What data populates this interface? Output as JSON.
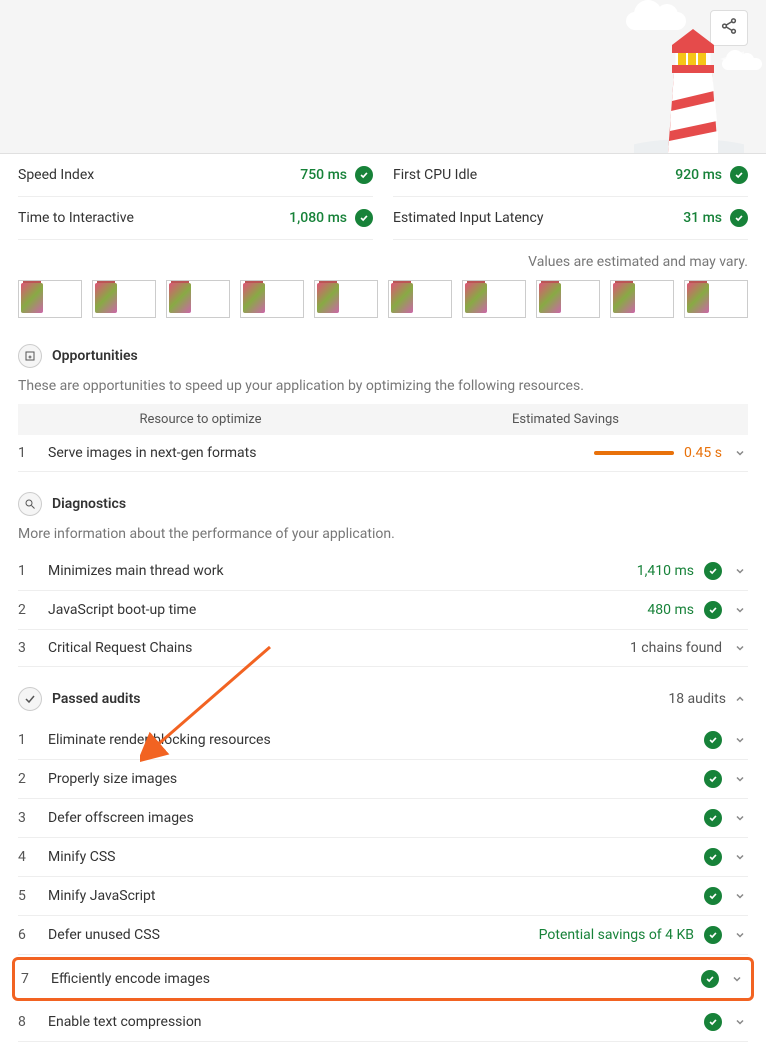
{
  "metrics": {
    "left": [
      {
        "label": "Speed Index",
        "value": "750 ms"
      },
      {
        "label": "Time to Interactive",
        "value": "1,080 ms"
      }
    ],
    "right": [
      {
        "label": "First CPU Idle",
        "value": "920 ms"
      },
      {
        "label": "Estimated Input Latency",
        "value": "31 ms"
      }
    ]
  },
  "estimated_note": "Values are estimated and may vary.",
  "opportunities": {
    "title": "Opportunities",
    "desc": "These are opportunities to speed up your application by optimizing the following resources.",
    "th_left": "Resource to optimize",
    "th_right": "Estimated Savings",
    "items": [
      {
        "num": "1",
        "title": "Serve images in next-gen formats",
        "savings": "0.45 s"
      }
    ]
  },
  "diagnostics": {
    "title": "Diagnostics",
    "desc": "More information about the performance of your application.",
    "items": [
      {
        "num": "1",
        "title": "Minimizes main thread work",
        "value": "1,410 ms",
        "pass": true
      },
      {
        "num": "2",
        "title": "JavaScript boot-up time",
        "value": "480 ms",
        "pass": true
      },
      {
        "num": "3",
        "title": "Critical Request Chains",
        "value": "1 chains found",
        "pass": false
      }
    ]
  },
  "passed": {
    "title": "Passed audits",
    "count": "18 audits",
    "items": [
      {
        "num": "1",
        "title": "Eliminate render-blocking resources",
        "note": ""
      },
      {
        "num": "2",
        "title": "Properly size images",
        "note": ""
      },
      {
        "num": "3",
        "title": "Defer offscreen images",
        "note": ""
      },
      {
        "num": "4",
        "title": "Minify CSS",
        "note": ""
      },
      {
        "num": "5",
        "title": "Minify JavaScript",
        "note": ""
      },
      {
        "num": "6",
        "title": "Defer unused CSS",
        "note": "Potential savings of 4 KB"
      },
      {
        "num": "7",
        "title": "Efficiently encode images",
        "note": "",
        "highlight": true
      },
      {
        "num": "8",
        "title": "Enable text compression",
        "note": ""
      }
    ]
  },
  "colors": {
    "pass": "#178239",
    "orange": "#e8710a",
    "highlight": "#f26322"
  }
}
